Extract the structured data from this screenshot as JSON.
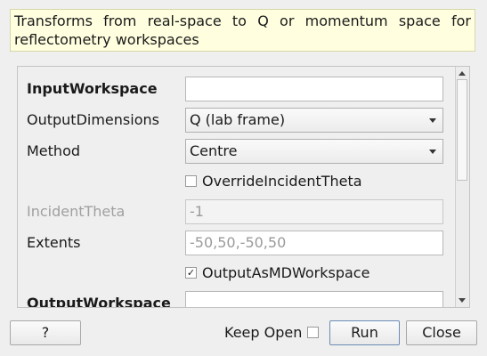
{
  "description": "Transforms from real-space to Q or momentum space for reflectometry workspaces",
  "properties": {
    "input_workspace": {
      "label": "InputWorkspace",
      "value": ""
    },
    "output_dimensions": {
      "label": "OutputDimensions",
      "value": "Q (lab frame)"
    },
    "method": {
      "label": "Method",
      "value": "Centre"
    },
    "override_incident_theta": {
      "label": "OverrideIncidentTheta",
      "checked": false
    },
    "incident_theta": {
      "label": "IncidentTheta",
      "value": "-1"
    },
    "extents": {
      "label": "Extents",
      "placeholder": "-50,50,-50,50"
    },
    "output_as_md_workspace": {
      "label": "OutputAsMDWorkspace",
      "checked": true,
      "check_mark": "✓"
    },
    "output_workspace": {
      "label": "OutputWorkspace",
      "value": ""
    }
  },
  "footer": {
    "help_label": "?",
    "keep_open_label": "Keep Open",
    "keep_open_checked": false,
    "run_label": "Run",
    "close_label": "Close"
  }
}
